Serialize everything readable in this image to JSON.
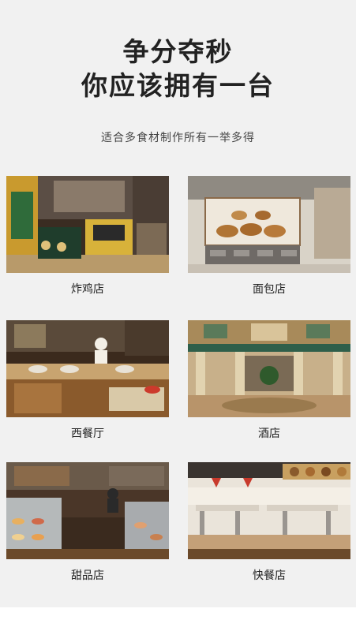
{
  "headline": {
    "line1": "争分夺秒",
    "line2": "你应该拥有一台"
  },
  "subtitle": "适合多食材制作所有一举多得",
  "venues": [
    {
      "label": "炸鸡店",
      "scene": "fried-chicken-shop-photo"
    },
    {
      "label": "面包店",
      "scene": "bakery-display-photo"
    },
    {
      "label": "西餐厅",
      "scene": "western-restaurant-buffet-photo"
    },
    {
      "label": "酒店",
      "scene": "hotel-lobby-photo"
    },
    {
      "label": "甜品店",
      "scene": "dessert-shop-counter-photo"
    },
    {
      "label": "快餐店",
      "scene": "fast-food-restaurant-photo"
    }
  ]
}
